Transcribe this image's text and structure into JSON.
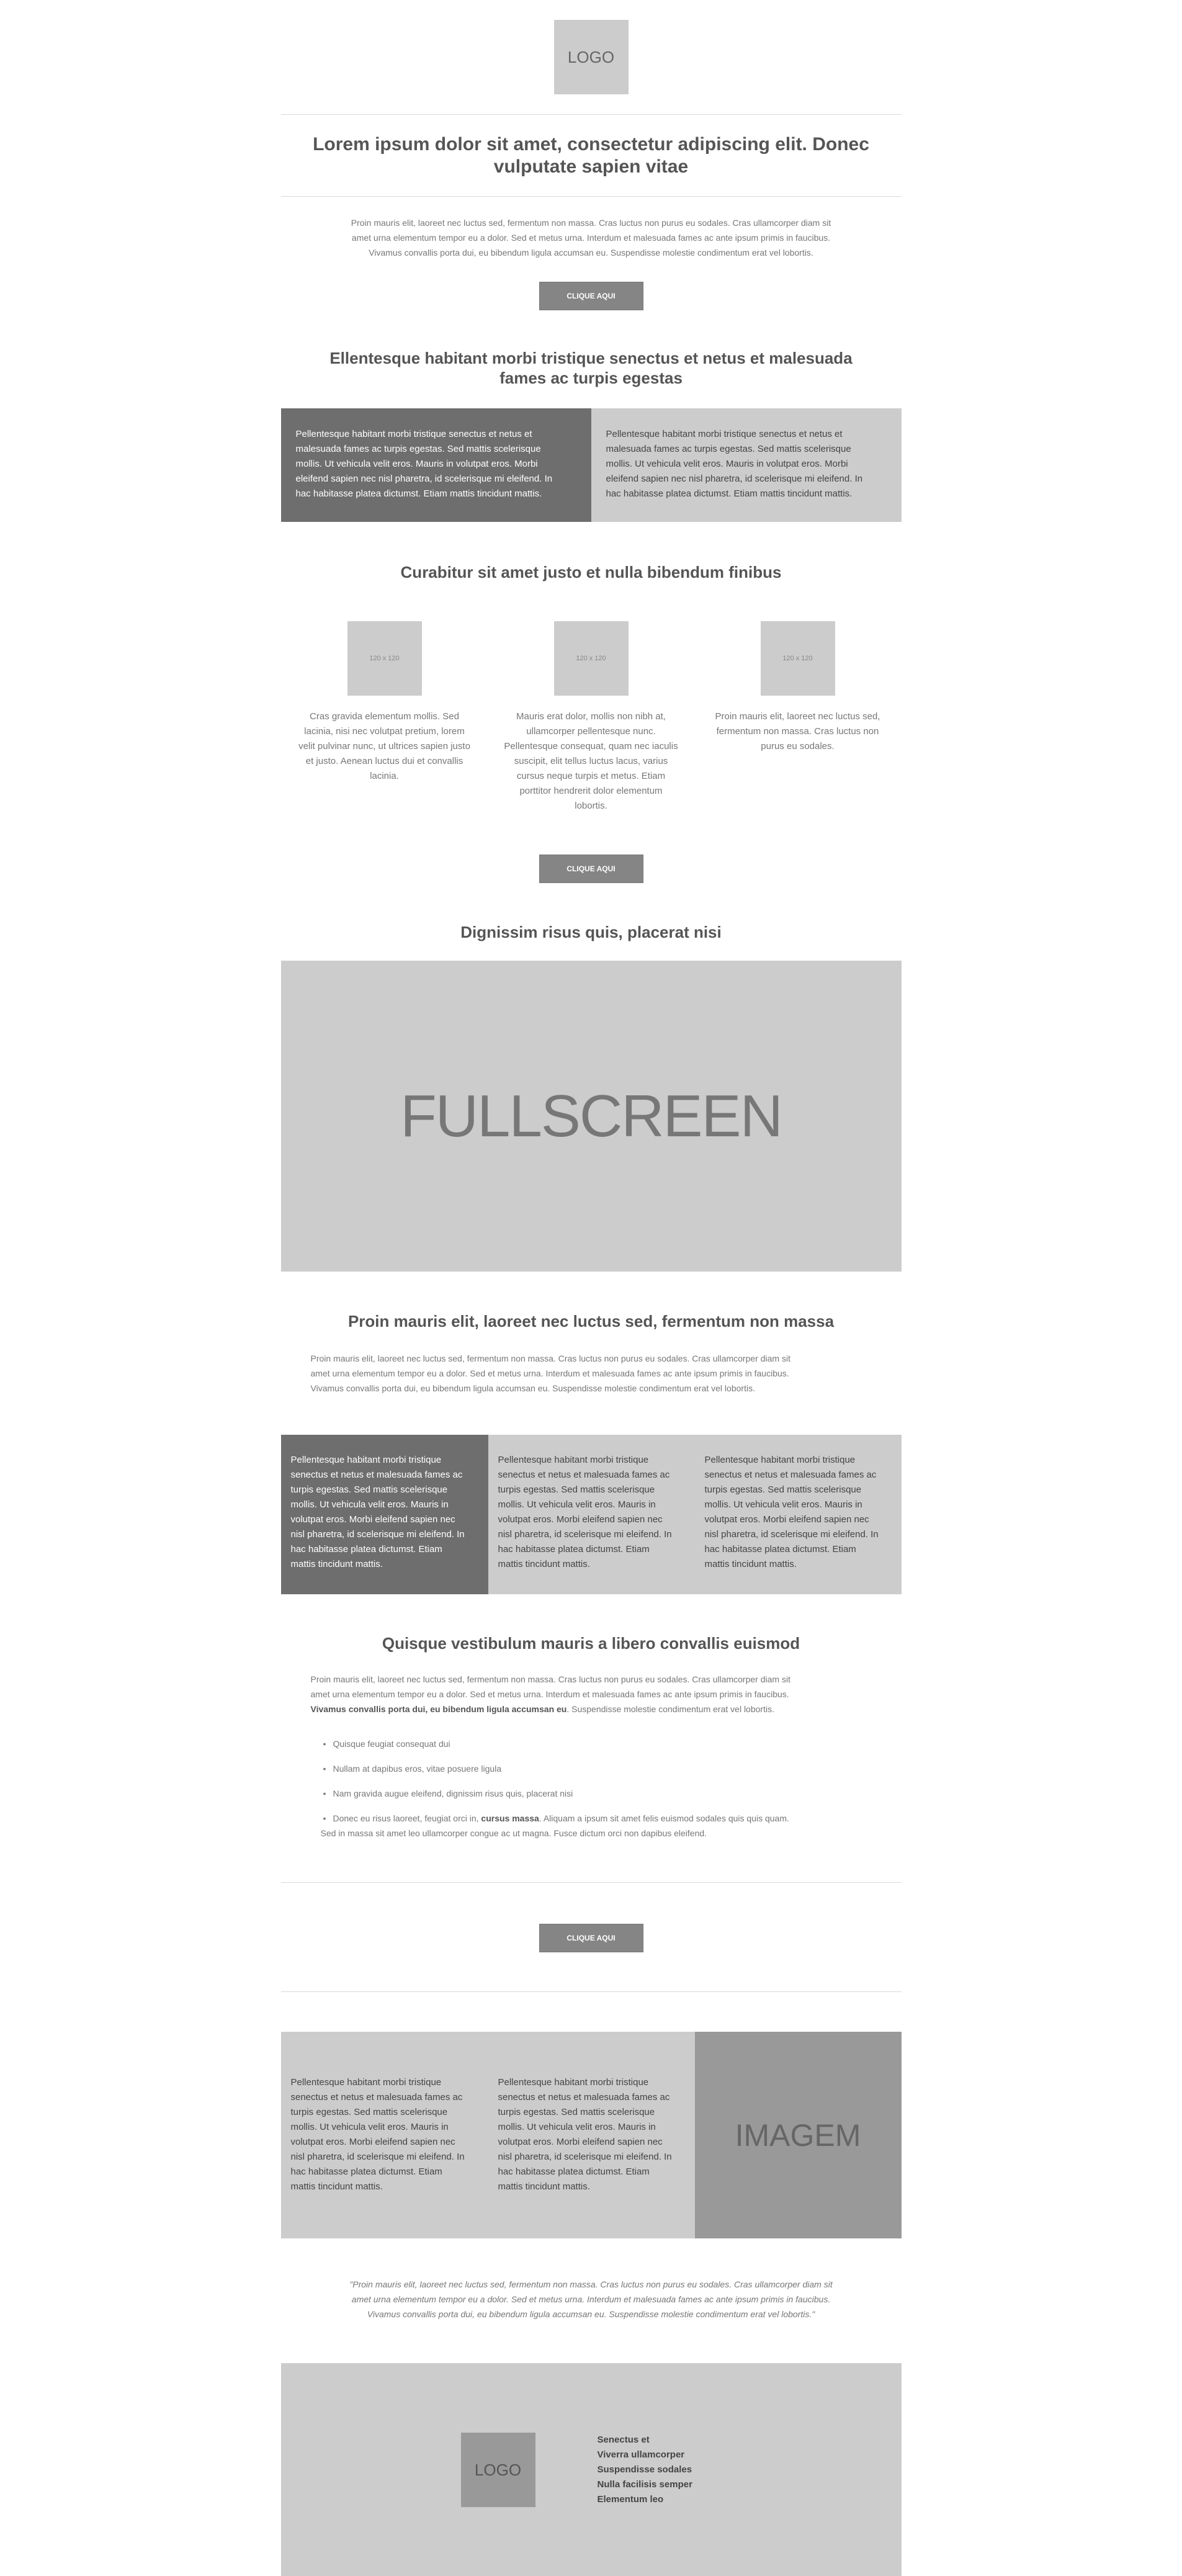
{
  "header": {
    "logo": "LOGO"
  },
  "hero": {
    "title": "Lorem ipsum dolor sit amet, consectetur adipiscing elit. Donec vulputate sapien vitae",
    "text_lines": [
      "Proin mauris elit, laoreet nec luctus sed, fermentum non massa. Cras luctus non purus eu sodales. Cras ullamcorper diam sit",
      "amet urna elementum tempor eu a dolor. Sed et metus urna. Interdum et malesuada fames ac ante ipsum primis in faucibus.",
      "Vivamus convallis porta dui, eu bibendum ligula accumsan eu. Suspendisse molestie condimentum erat vel lobortis."
    ],
    "button": "CLIQUE AQUI"
  },
  "section2": {
    "title_lines": [
      "Ellentesque habitant morbi tristique senectus et netus et malesuada",
      "fames ac turpis egestas"
    ],
    "panel_left": [
      "Pellentesque habitant morbi tristique senectus et netus et",
      "malesuada fames ac turpis egestas. Sed mattis scelerisque",
      "mollis. Ut vehicula velit eros. Mauris in volutpat eros. Morbi",
      "eleifend sapien nec nisl pharetra, id scelerisque mi eleifend. In",
      "hac habitasse platea dictumst. Etiam mattis tincidunt mattis."
    ],
    "panel_right": [
      "Pellentesque habitant morbi tristique senectus et netus et",
      "malesuada fames ac turpis egestas. Sed mattis scelerisque",
      "mollis. Ut vehicula velit eros. Mauris in volutpat eros. Morbi",
      "eleifend sapien nec nisl pharetra, id scelerisque mi eleifend. In",
      "hac habitasse platea dictumst. Etiam mattis tincidunt mattis."
    ]
  },
  "section3": {
    "title": "Curabitur sit amet justo et nulla bibendum finibus",
    "thumb_label": "120 x 120",
    "col1": [
      "Cras gravida elementum mollis. Sed",
      "lacinia, nisi nec volutpat pretium, lorem",
      "velit pulvinar nunc, ut ultrices sapien justo",
      "et justo. Aenean luctus dui et convallis",
      "lacinia."
    ],
    "col2": [
      "Mauris erat dolor, mollis non nibh at,",
      "ullamcorper pellentesque nunc.",
      "Pellentesque consequat, quam nec iaculis",
      "suscipit, elit tellus luctus lacus, varius",
      "cursus neque turpis et metus. Etiam",
      "porttitor hendrerit dolor elementum",
      "lobortis."
    ],
    "col3": [
      "Proin mauris elit, laoreet nec luctus sed,",
      "fermentum non massa. Cras luctus non",
      "purus eu sodales."
    ],
    "button": "CLIQUE AQUI"
  },
  "section4": {
    "title": "Dignissim risus quis, placerat nisi",
    "banner": "FULLSCREEN"
  },
  "section5": {
    "title": "Proin mauris elit, laoreet nec luctus sed, fermentum non massa",
    "text_lines": [
      "Proin mauris elit, laoreet nec luctus sed, fermentum non massa. Cras luctus non purus eu sodales. Cras ullamcorper diam sit",
      "amet urna elementum tempor eu a dolor. Sed et metus urna. Interdum et malesuada fames ac ante ipsum primis in faucibus.",
      "Vivamus convallis porta dui, eu bibendum ligula accumsan eu. Suspendisse molestie condimentum erat vel lobortis."
    ],
    "panel_lines": [
      "Pellentesque habitant morbi tristique",
      "senectus et netus et malesuada fames ac",
      "turpis egestas. Sed mattis scelerisque",
      "mollis. Ut vehicula velit eros. Mauris in",
      "volutpat eros. Morbi eleifend sapien nec",
      "nisl pharetra, id scelerisque mi eleifend. In",
      "hac habitasse platea dictumst. Etiam",
      "mattis tincidunt mattis."
    ]
  },
  "section6": {
    "title": "Quisque vestibulum mauris a libero convallis euismod",
    "text_line1": "Proin mauris elit, laoreet nec luctus sed, fermentum non massa. Cras luctus non purus eu sodales. Cras ullamcorper diam sit",
    "text_line2": "amet urna elementum tempor eu a dolor. Sed et metus urna. Interdum et malesuada fames ac ante ipsum primis in faucibus.",
    "text_line3_bold": "Vivamus convallis porta dui, eu bibendum ligula accumsan eu",
    "text_line3_rest": ". Suspendisse molestie condimentum erat vel lobortis.",
    "bullet": "•",
    "items": [
      "Quisque feugiat consequat dui",
      "Nullam at dapibus eros, vitae posuere ligula",
      "Nam gravida augue eleifend, dignissim risus quis, placerat nisi"
    ],
    "item4_pre": "Donec eu risus laoreet, feugiat orci in, ",
    "item4_bold": "cursus massa",
    "item4_post": ". Aliquam a ipsum sit amet felis euismod sodales quis quis quam.",
    "item4_line2": "Sed in massa sit amet leo ullamcorper congue ac ut magna. Fusce dictum orci non dapibus eleifend.",
    "button": "CLIQUE AQUI"
  },
  "section7": {
    "image_label": "IMAGEM",
    "panel_lines": [
      "Pellentesque habitant morbi tristique",
      "senectus et netus et malesuada fames ac",
      "turpis egestas. Sed mattis scelerisque",
      "mollis. Ut vehicula velit eros. Mauris in",
      "volutpat eros. Morbi eleifend sapien nec",
      "nisl pharetra, id scelerisque mi eleifend. In",
      "hac habitasse platea dictumst. Etiam",
      "mattis tincidunt mattis."
    ]
  },
  "quote": {
    "lines": [
      "\"Proin mauris elit, laoreet nec luctus sed, fermentum non massa. Cras luctus non purus eu sodales. Cras ullamcorper diam sit",
      "amet urna elementum tempor eu a dolor. Sed et metus urna. Interdum et malesuada fames ac ante ipsum primis in faucibus.",
      "Vivamus convallis porta dui, eu bibendum ligula accumsan eu. Suspendisse molestie condimentum erat vel lobortis.\""
    ]
  },
  "footer": {
    "logo": "LOGO",
    "links": [
      "Senectus et",
      "Viverra ullamcorper",
      "Suspendisse sodales",
      "Nulla facilisis semper",
      "Elementum leo"
    ]
  }
}
